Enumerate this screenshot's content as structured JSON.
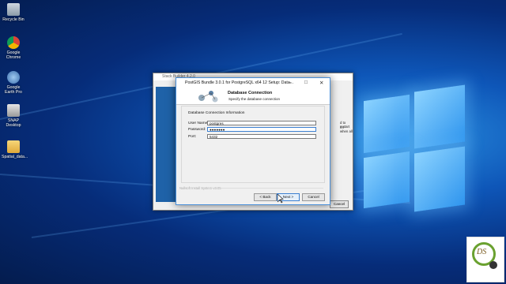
{
  "desktop": {
    "icons": [
      {
        "label": "Recycle Bin",
        "icon": "recycle-bin-icon"
      },
      {
        "label": "Google Chrome",
        "icon": "chrome-icon"
      },
      {
        "label": "Google Earth Pro",
        "icon": "google-earth-icon"
      },
      {
        "label": "SNAP Desktop",
        "icon": "snap-desktop-icon"
      },
      {
        "label": "Spatial_data...",
        "icon": "folder-icon"
      }
    ]
  },
  "back_window": {
    "title": "Stack Builder 4.2.0",
    "right_text_1": "d to restart",
    "right_text_2": "rer when all",
    "cancel_label": "Cancel"
  },
  "dialog": {
    "title": "PostGIS Bundle 3.0.1 for PostgreSQL x64 12 Setup: Data...",
    "controls": {
      "minimize": "–",
      "maximize": "□",
      "close": "✕"
    },
    "header_title": "Database Connection",
    "header_subtitle": "Specify the database connection",
    "group_label": "Database Connection Information",
    "fields": {
      "username_label": "User Name:",
      "username_value": "postgres",
      "password_label": "Password:",
      "password_value": "●●●●●●●",
      "port_label": "Port:",
      "port_value": "5432"
    },
    "footer_text": "Nullsoft Install System v3.05",
    "buttons": {
      "back": "< Back",
      "next": "Next >",
      "cancel": "Cancel"
    }
  },
  "watermark": {
    "text": "DS"
  }
}
